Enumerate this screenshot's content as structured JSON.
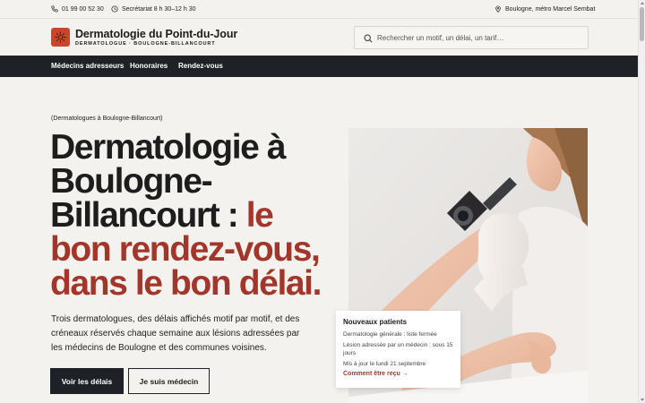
{
  "topbar": {
    "phone": "01 99 00 52 30",
    "hours": "Secrétariat 8 h 30–12 h 30",
    "location": "Boulogne, métro Marcel Sembat"
  },
  "header": {
    "brand_name": "Dermatologie du Point-du-Jour",
    "brand_sub": "DERMATOLOGUE · BOULOGNE-BILLANCOURT",
    "search_placeholder": "Rechercher un motif, un délai, un tarif…",
    "logo_icon": "sun-icon"
  },
  "nav": {
    "items": [
      {
        "label": "Médecins adresseurs"
      },
      {
        "label": "Honoraires"
      },
      {
        "label": "Rendez-vous"
      }
    ]
  },
  "hero": {
    "eyebrow": "(Dermatologues à Boulogne-Billancourt)",
    "headline_dark": "Dermatologie à Boulogne-Billancourt : ",
    "headline_accent": "le bon rendez-vous, dans le bon délai.",
    "lede": "Trois dermatologues, des délais affichés motif par motif, et des créneaux réservés chaque semaine aux lésions adressées par les médecins de Boulogne et des communes voisines.",
    "btn_primary": "Voir les délais",
    "btn_secondary": "Je suis médecin"
  },
  "card": {
    "title": "Nouveaux patients",
    "line1": "Dermatologie générale : liste fermée",
    "line2": "Lésion adressée par un médecin : sous 15 jours",
    "line3": "Mis à jour le lundi 21 septembre",
    "link": "Comment être reçu →"
  },
  "colors": {
    "accent": "#a3362a",
    "logo_bg": "#c9452c",
    "nav_bg": "#1e2125",
    "page_bg": "#f4f2ee"
  }
}
